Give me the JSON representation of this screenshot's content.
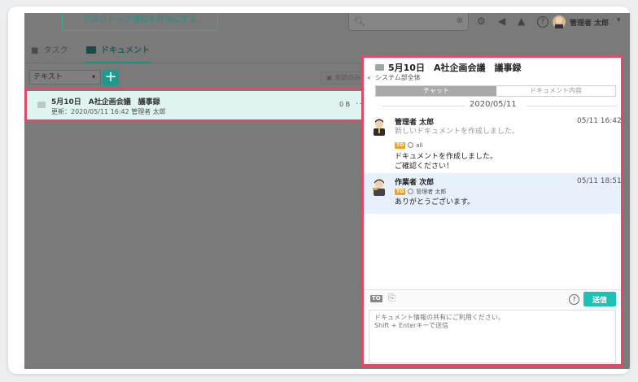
{
  "header": {
    "notify_button": "デスクトップ通知を有効にする",
    "search_placeholder": "",
    "user_name": "管理者 太郎"
  },
  "tabs": [
    {
      "label": "タスク",
      "icon": "task-icon"
    },
    {
      "label": "ドキュメント",
      "icon": "document-icon",
      "active": true
    }
  ],
  "filter": {
    "type_select": "テキスト",
    "add_label": "+",
    "unread_label": "未読のみ"
  },
  "document_list": [
    {
      "title": "5月10日　A社企画会議　議事録",
      "meta": "更新：2020/05/11 16:42  管理者 太郎",
      "size": "0 B",
      "more": "···"
    }
  ],
  "panel": {
    "title": "5月10日　A社企画会議　議事録",
    "subtitle": "システム部全体",
    "collapse_icon": "«",
    "tab_chat": "チャット",
    "tab_content": "ドキュメント内容",
    "date": "2020/05/11",
    "messages": [
      {
        "author": "管理者 太郎",
        "time": "05/11 16:42",
        "system_text": "新しいドキュメントを作成しました。",
        "to_tag": "TO",
        "to_target": "all",
        "lines": [
          "ドキュメントを作成しました。",
          "ご確認ください！"
        ]
      },
      {
        "author": "作業者 次郎",
        "time": "05/11 18:51",
        "to_tag": "TO",
        "to_target": "管理者 太郎",
        "lines": [
          "ありがとうございます。"
        ]
      }
    ],
    "toolbar": {
      "to_label": "TO",
      "help_label": "?",
      "send_label": "送信"
    },
    "composer_placeholder": "ドキュメント情報の共有にご利用ください。\nShift + Enterキーで送信"
  },
  "colors": {
    "accent": "#1dc2b7",
    "highlight_border": "#e04a64",
    "selected_row": "#dff3f1",
    "to_tag": "#f3a320"
  }
}
